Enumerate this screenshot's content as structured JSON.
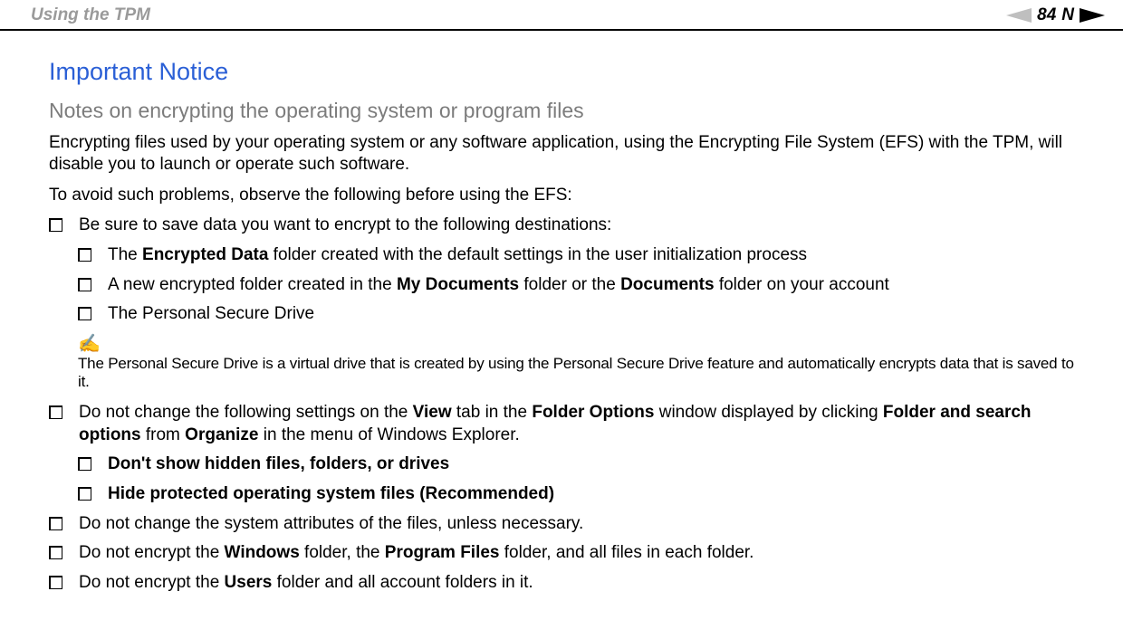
{
  "header": {
    "title": "Using the TPM",
    "page_number": "84",
    "nav_letter": "N"
  },
  "headings": {
    "main": "Important Notice",
    "sub": "Notes on encrypting the operating system or program files"
  },
  "paragraphs": {
    "p1": "Encrypting files used by your operating system or any software application, using the Encrypting File System (EFS) with the TPM, will disable you to launch or operate such software.",
    "p2": "To avoid such problems, observe the following before using the EFS:"
  },
  "list1": {
    "item1": "Be sure to save data you want to encrypt to the following destinations:",
    "sub": {
      "s1_pre": "The ",
      "s1_b": "Encrypted Data",
      "s1_post": " folder created with the default settings in the user initialization process",
      "s2_pre": "A new encrypted folder created in the ",
      "s2_b1": "My Documents",
      "s2_mid": " folder or the ",
      "s2_b2": "Documents",
      "s2_post": " folder on your account",
      "s3": "The Personal Secure Drive"
    }
  },
  "note": {
    "text": "The Personal Secure Drive is a virtual drive that is created by using the Personal Secure Drive feature and automatically encrypts data that is saved to it."
  },
  "list2": {
    "item2_pre": "Do not change the following settings on the ",
    "item2_b1": "View",
    "item2_mid1": " tab in the ",
    "item2_b2": "Folder Options",
    "item2_mid2": " window displayed by clicking ",
    "item2_b3": "Folder and search options",
    "item2_mid3": " from ",
    "item2_b4": "Organize",
    "item2_post": " in the menu of Windows Explorer.",
    "sub": {
      "s1": "Don't show hidden files, folders, or drives",
      "s2": "Hide protected operating system files (Recommended)"
    },
    "item3": "Do not change the system attributes of the files, unless necessary.",
    "item4_pre": "Do not encrypt the ",
    "item4_b1": "Windows",
    "item4_mid1": " folder, the ",
    "item4_b2": "Program Files",
    "item4_post": " folder, and all files in each folder.",
    "item5_pre": "Do not encrypt the ",
    "item5_b1": "Users",
    "item5_post": " folder and all account folders in it."
  }
}
